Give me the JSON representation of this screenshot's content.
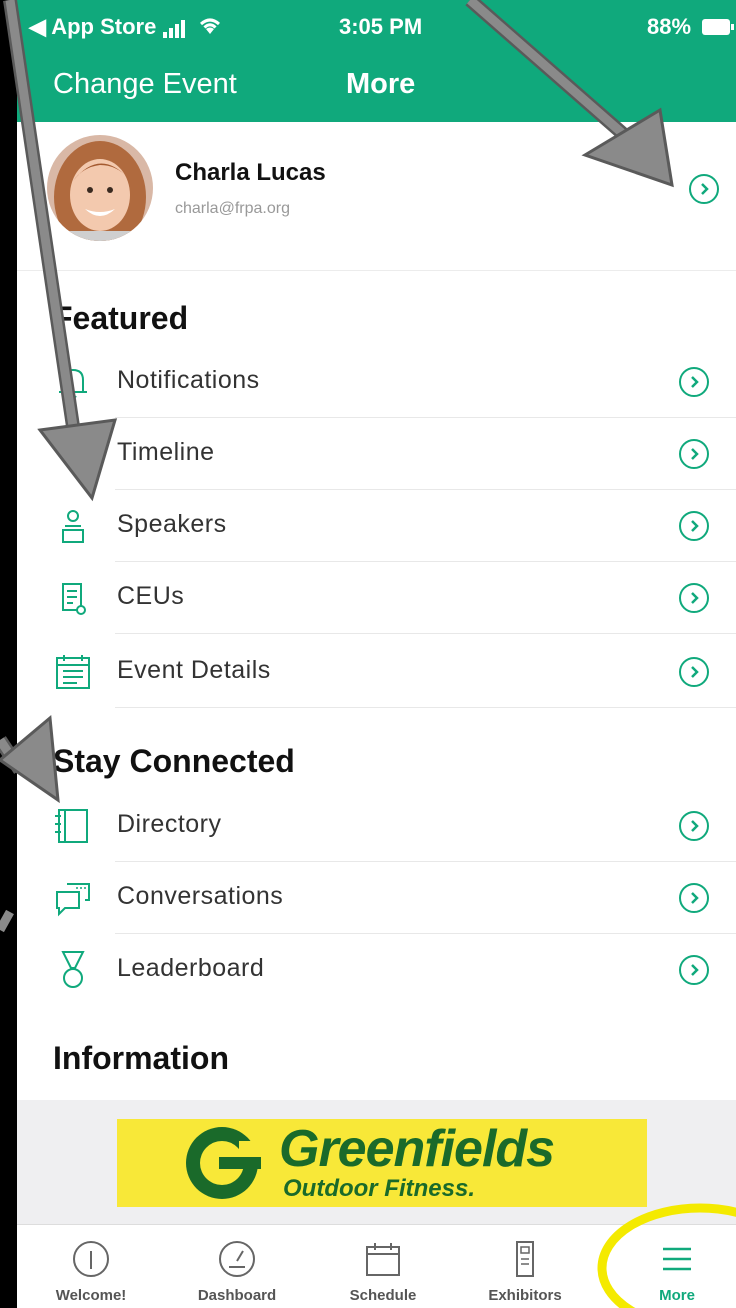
{
  "status_bar": {
    "back_app": "◀ App Store",
    "time": "3:05 PM",
    "battery": "88%"
  },
  "nav": {
    "left_action": "Change Event",
    "title": "More"
  },
  "profile": {
    "name": "Charla Lucas",
    "email": "charla@frpa.org"
  },
  "sections": {
    "featured": {
      "title": "Featured",
      "items": [
        {
          "label": "Notifications",
          "icon": "bell-icon"
        },
        {
          "label": "Timeline",
          "icon": "timeline-icon"
        },
        {
          "label": "Speakers",
          "icon": "speaker-icon"
        },
        {
          "label": "CEUs",
          "icon": "certificate-icon"
        },
        {
          "label": "Event Details",
          "icon": "calendar-icon"
        }
      ]
    },
    "stay_connected": {
      "title": "Stay Connected",
      "items": [
        {
          "label": "Directory",
          "icon": "book-icon"
        },
        {
          "label": "Conversations",
          "icon": "chat-icon"
        },
        {
          "label": "Leaderboard",
          "icon": "medal-icon"
        }
      ]
    },
    "information": {
      "title": "Information"
    }
  },
  "banner": {
    "brand": "Greenfields",
    "tagline": "Outdoor Fitness."
  },
  "tabs": [
    {
      "label": "Welcome!",
      "icon": "info-icon"
    },
    {
      "label": "Dashboard",
      "icon": "gauge-icon"
    },
    {
      "label": "Schedule",
      "icon": "calendar-icon"
    },
    {
      "label": "Exhibitors",
      "icon": "door-icon"
    },
    {
      "label": "More",
      "icon": "menu-icon",
      "active": true
    }
  ],
  "colors": {
    "accent": "#10a97c",
    "banner_bg": "#f8e838",
    "banner_text": "#1a6a2a",
    "highlight": "#f4ea00",
    "annotation_arrow": "#8a8a8a"
  }
}
